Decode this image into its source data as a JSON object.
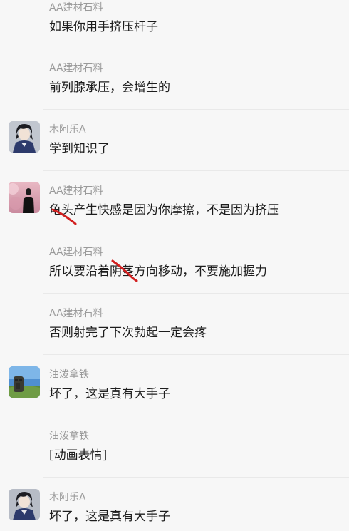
{
  "messages": [
    {
      "sender": "AA建材石料",
      "text": "如果你用手挤压杆子",
      "avatar": null
    },
    {
      "sender": "AA建材石料",
      "text": "前列腺承压，会增生的",
      "avatar": null
    },
    {
      "sender": "木阿乐A",
      "text": "学到知识了",
      "avatar": "anime-boy-avatar"
    },
    {
      "sender": "AA建材石料",
      "text": "龟头产生快感是因为你摩擦，不是因为挤压",
      "avatar": "silhouette-avatar"
    },
    {
      "sender": "AA建材石料",
      "text": "所以要沿着阴茎方向移动，不要施加握力",
      "avatar": null
    },
    {
      "sender": "AA建材石料",
      "text": "否则射完了下次勃起一定会疼",
      "avatar": null
    },
    {
      "sender": "油泼拿铁",
      "text": "坏了，这是真有大手子",
      "avatar": "moai-avatar"
    },
    {
      "sender": "油泼拿铁",
      "text": "[动画表情]",
      "avatar": null
    },
    {
      "sender": "木阿乐A",
      "text": "坏了，这是真有大手子",
      "avatar": "anime-boy-avatar"
    }
  ],
  "colors": {
    "background": "#f7f7f7",
    "sender": "#9a9a9a",
    "text": "#1d1d1d",
    "scribble": "#d21f1f"
  }
}
